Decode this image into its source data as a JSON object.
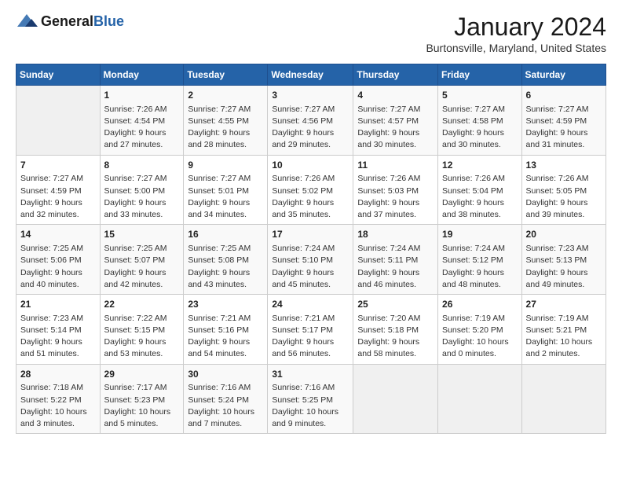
{
  "header": {
    "logo_general": "General",
    "logo_blue": "Blue",
    "month_year": "January 2024",
    "location": "Burtonsville, Maryland, United States"
  },
  "days_of_week": [
    "Sunday",
    "Monday",
    "Tuesday",
    "Wednesday",
    "Thursday",
    "Friday",
    "Saturday"
  ],
  "weeks": [
    [
      {
        "day": "",
        "info": ""
      },
      {
        "day": "1",
        "info": "Sunrise: 7:26 AM\nSunset: 4:54 PM\nDaylight: 9 hours\nand 27 minutes."
      },
      {
        "day": "2",
        "info": "Sunrise: 7:27 AM\nSunset: 4:55 PM\nDaylight: 9 hours\nand 28 minutes."
      },
      {
        "day": "3",
        "info": "Sunrise: 7:27 AM\nSunset: 4:56 PM\nDaylight: 9 hours\nand 29 minutes."
      },
      {
        "day": "4",
        "info": "Sunrise: 7:27 AM\nSunset: 4:57 PM\nDaylight: 9 hours\nand 30 minutes."
      },
      {
        "day": "5",
        "info": "Sunrise: 7:27 AM\nSunset: 4:58 PM\nDaylight: 9 hours\nand 30 minutes."
      },
      {
        "day": "6",
        "info": "Sunrise: 7:27 AM\nSunset: 4:59 PM\nDaylight: 9 hours\nand 31 minutes."
      }
    ],
    [
      {
        "day": "7",
        "info": "Sunrise: 7:27 AM\nSunset: 4:59 PM\nDaylight: 9 hours\nand 32 minutes."
      },
      {
        "day": "8",
        "info": "Sunrise: 7:27 AM\nSunset: 5:00 PM\nDaylight: 9 hours\nand 33 minutes."
      },
      {
        "day": "9",
        "info": "Sunrise: 7:27 AM\nSunset: 5:01 PM\nDaylight: 9 hours\nand 34 minutes."
      },
      {
        "day": "10",
        "info": "Sunrise: 7:26 AM\nSunset: 5:02 PM\nDaylight: 9 hours\nand 35 minutes."
      },
      {
        "day": "11",
        "info": "Sunrise: 7:26 AM\nSunset: 5:03 PM\nDaylight: 9 hours\nand 37 minutes."
      },
      {
        "day": "12",
        "info": "Sunrise: 7:26 AM\nSunset: 5:04 PM\nDaylight: 9 hours\nand 38 minutes."
      },
      {
        "day": "13",
        "info": "Sunrise: 7:26 AM\nSunset: 5:05 PM\nDaylight: 9 hours\nand 39 minutes."
      }
    ],
    [
      {
        "day": "14",
        "info": "Sunrise: 7:25 AM\nSunset: 5:06 PM\nDaylight: 9 hours\nand 40 minutes."
      },
      {
        "day": "15",
        "info": "Sunrise: 7:25 AM\nSunset: 5:07 PM\nDaylight: 9 hours\nand 42 minutes."
      },
      {
        "day": "16",
        "info": "Sunrise: 7:25 AM\nSunset: 5:08 PM\nDaylight: 9 hours\nand 43 minutes."
      },
      {
        "day": "17",
        "info": "Sunrise: 7:24 AM\nSunset: 5:10 PM\nDaylight: 9 hours\nand 45 minutes."
      },
      {
        "day": "18",
        "info": "Sunrise: 7:24 AM\nSunset: 5:11 PM\nDaylight: 9 hours\nand 46 minutes."
      },
      {
        "day": "19",
        "info": "Sunrise: 7:24 AM\nSunset: 5:12 PM\nDaylight: 9 hours\nand 48 minutes."
      },
      {
        "day": "20",
        "info": "Sunrise: 7:23 AM\nSunset: 5:13 PM\nDaylight: 9 hours\nand 49 minutes."
      }
    ],
    [
      {
        "day": "21",
        "info": "Sunrise: 7:23 AM\nSunset: 5:14 PM\nDaylight: 9 hours\nand 51 minutes."
      },
      {
        "day": "22",
        "info": "Sunrise: 7:22 AM\nSunset: 5:15 PM\nDaylight: 9 hours\nand 53 minutes."
      },
      {
        "day": "23",
        "info": "Sunrise: 7:21 AM\nSunset: 5:16 PM\nDaylight: 9 hours\nand 54 minutes."
      },
      {
        "day": "24",
        "info": "Sunrise: 7:21 AM\nSunset: 5:17 PM\nDaylight: 9 hours\nand 56 minutes."
      },
      {
        "day": "25",
        "info": "Sunrise: 7:20 AM\nSunset: 5:18 PM\nDaylight: 9 hours\nand 58 minutes."
      },
      {
        "day": "26",
        "info": "Sunrise: 7:19 AM\nSunset: 5:20 PM\nDaylight: 10 hours\nand 0 minutes."
      },
      {
        "day": "27",
        "info": "Sunrise: 7:19 AM\nSunset: 5:21 PM\nDaylight: 10 hours\nand 2 minutes."
      }
    ],
    [
      {
        "day": "28",
        "info": "Sunrise: 7:18 AM\nSunset: 5:22 PM\nDaylight: 10 hours\nand 3 minutes."
      },
      {
        "day": "29",
        "info": "Sunrise: 7:17 AM\nSunset: 5:23 PM\nDaylight: 10 hours\nand 5 minutes."
      },
      {
        "day": "30",
        "info": "Sunrise: 7:16 AM\nSunset: 5:24 PM\nDaylight: 10 hours\nand 7 minutes."
      },
      {
        "day": "31",
        "info": "Sunrise: 7:16 AM\nSunset: 5:25 PM\nDaylight: 10 hours\nand 9 minutes."
      },
      {
        "day": "",
        "info": ""
      },
      {
        "day": "",
        "info": ""
      },
      {
        "day": "",
        "info": ""
      }
    ]
  ]
}
